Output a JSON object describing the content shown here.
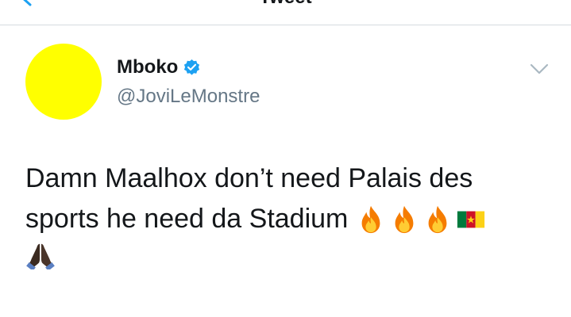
{
  "header": {
    "back_icon": "chevron-left-icon",
    "title": "Tweet"
  },
  "tweet": {
    "author": {
      "display_name": "Mboko",
      "handle": "@JoviLeMonstre",
      "verified": true,
      "avatar_color": "#ffff00"
    },
    "menu_icon": "chevron-down-icon",
    "text_line1": "Damn Maalhox don’t need Palais des",
    "text_line2": "sports he need da Stadium",
    "emojis": [
      "fire-icon",
      "fire-icon",
      "fire-icon",
      "cameroon-flag-icon",
      "folded-hands-icon"
    ]
  },
  "colors": {
    "accent": "#1da1f2",
    "secondary_text": "#657786",
    "divider": "#d6dbdf"
  }
}
